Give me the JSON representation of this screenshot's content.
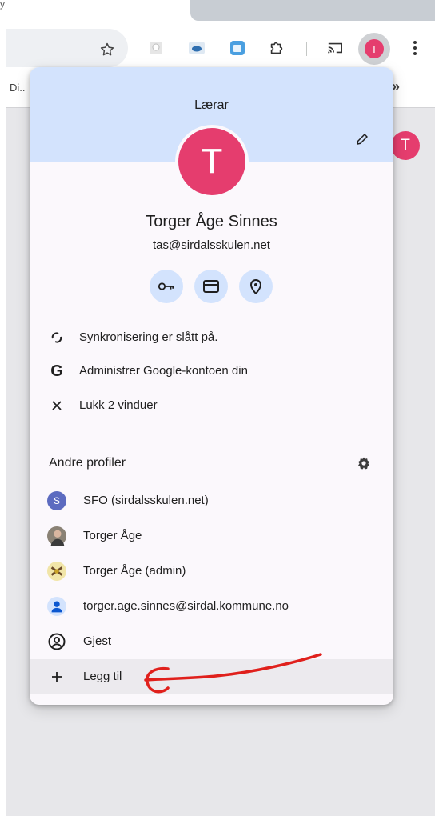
{
  "bookmarks": {
    "first": "Di..",
    "more": "»"
  },
  "menu": {
    "header_label": "Lærar",
    "avatar_initial": "T",
    "user_name": "Torger Åge Sinnes",
    "user_email": "tas@sirdalsskulen.net",
    "quick_buttons": [
      "key-icon",
      "credit-card-icon",
      "location-pin-icon"
    ],
    "actions": [
      {
        "icon": "sync-icon",
        "label": "Synkronisering er slått på."
      },
      {
        "icon": "google-g-icon",
        "label": "Administrer Google-kontoen din"
      },
      {
        "icon": "close-icon",
        "label": "Lukk 2 vinduer"
      }
    ],
    "other_profiles_title": "Andre profiler",
    "profiles": [
      {
        "avatar": "S",
        "label": "SFO (sirdalsskulen.net)"
      },
      {
        "avatar": "photo",
        "label": "Torger Åge"
      },
      {
        "avatar": "photo",
        "label": "Torger Åge (admin)"
      },
      {
        "avatar": "person-icon",
        "label": "torger.age.sinnes@sirdal.kommune.no"
      },
      {
        "avatar": "guest-icon",
        "label": "Gjest"
      }
    ],
    "add_label": "Legg til"
  },
  "toolbar": {
    "avatar_initial": "T"
  },
  "page": {
    "avatar_initial": "T"
  },
  "colors": {
    "accent_pink": "#e53d6e",
    "header_blue": "#d3e3fd",
    "annotation_red": "#e0201c"
  }
}
